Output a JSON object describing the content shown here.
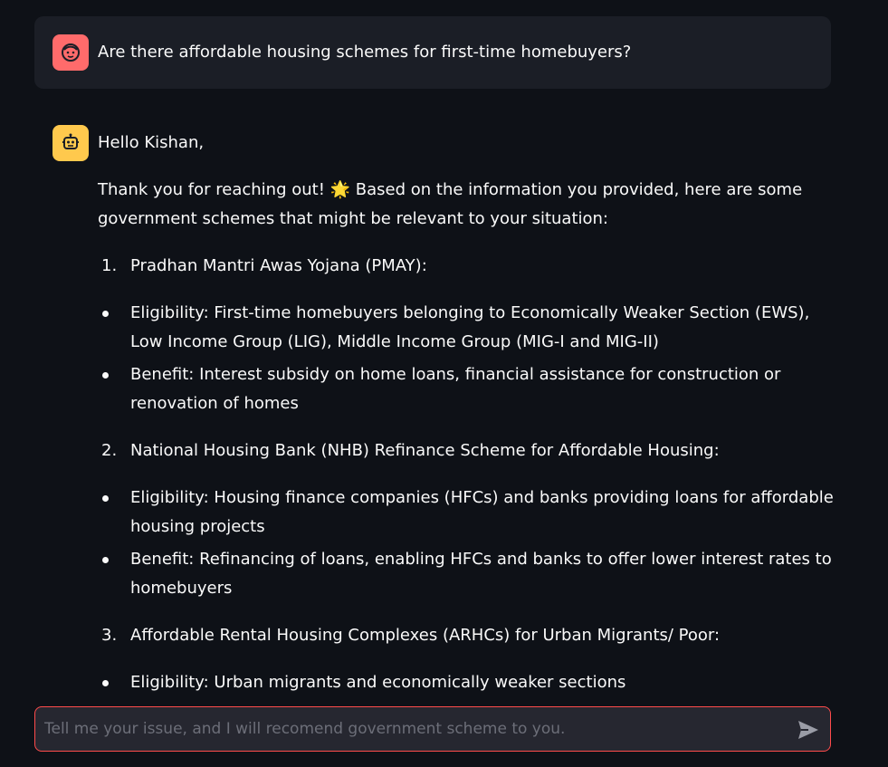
{
  "user_message": {
    "text": "Are there affordable housing schemes for first-time homebuyers?",
    "avatar_icon": "user-face-icon"
  },
  "assistant_message": {
    "avatar_icon": "robot-icon",
    "greeting": "Hello Kishan,",
    "intro_pre": "Thank you for reaching out! ",
    "intro_emoji": "🌟",
    "intro_post": " Based on the information you provided, here are some government schemes that might be relevant to your situation:",
    "schemes": [
      {
        "number": "1.",
        "title": "Pradhan Mantri Awas Yojana (PMAY):",
        "bullets": [
          "Eligibility: First-time homebuyers belonging to Economically Weaker Section (EWS), Low Income Group (LIG), Middle Income Group (MIG-I and MIG-II)",
          "Benefit: Interest subsidy on home loans, financial assistance for construction or renovation of homes"
        ]
      },
      {
        "number": "2.",
        "title": "National Housing Bank (NHB) Refinance Scheme for Affordable Housing:",
        "bullets": [
          "Eligibility: Housing finance companies (HFCs) and banks providing loans for affordable housing projects",
          "Benefit: Refinancing of loans, enabling HFCs and banks to offer lower interest rates to homebuyers"
        ]
      },
      {
        "number": "3.",
        "title": "Affordable Rental Housing Complexes (ARHCs) for Urban Migrants/ Poor:",
        "bullets": [
          "Eligibility: Urban migrants and economically weaker sections"
        ]
      }
    ]
  },
  "chat_input": {
    "placeholder": "Tell me your issue, and I will recomend government scheme to you.",
    "value": "",
    "send_icon": "send-icon"
  },
  "colors": {
    "background": "#0e1117",
    "user_bubble": "#1b1e26",
    "user_avatar": "#ff6b6b",
    "bot_avatar": "#ffc94d",
    "input_border": "#ff4b4b"
  }
}
